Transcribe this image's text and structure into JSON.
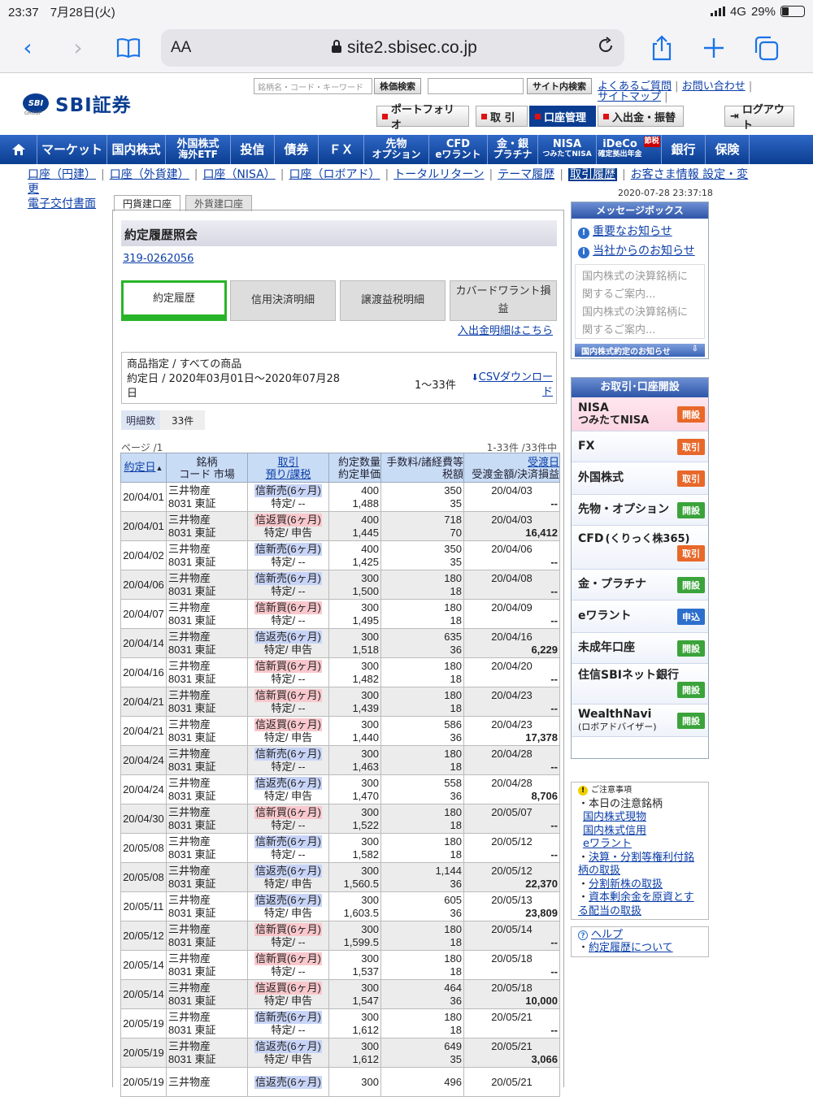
{
  "status": {
    "time": "23:37",
    "date": "7月28日(火)",
    "network": "4G",
    "battery": "29%",
    "battery_level": 0.29
  },
  "browser": {
    "text_size": "AA",
    "url": "site2.sbisec.co.jp",
    "icons": [
      "back-icon",
      "forward-icon",
      "bookmarks-icon",
      "lock-icon",
      "reload-icon",
      "share-icon",
      "add-icon",
      "tabs-icon"
    ]
  },
  "header": {
    "logo_mark": "SBI",
    "logo_sub": "GROUP",
    "logo_text": "SBI証券",
    "search_placeholder": "銘柄名・コード・キーワード",
    "stock_search": "株価検索",
    "site_search": "サイト内検索",
    "faq": "よくあるご質問",
    "contact": "お問い合わせ",
    "sitemap": "サイトマップ",
    "portfolio": "ポートフォリオ",
    "trade": "取 引",
    "account": "口座管理",
    "deposit": "入出金・振替",
    "logout": "ログアウト"
  },
  "mainnav": [
    {
      "label": "",
      "icon": "home-icon"
    },
    {
      "label": "マーケット"
    },
    {
      "label": "国内株式"
    },
    {
      "label": "外国株式",
      "sub": "海外ETF"
    },
    {
      "label": "投信"
    },
    {
      "label": "債券"
    },
    {
      "label": "ＦＸ"
    },
    {
      "label": "先物",
      "sub": "オプション"
    },
    {
      "label": "CFD",
      "sub": "eワラント"
    },
    {
      "label": "金・銀",
      "sub": "プラチナ"
    },
    {
      "label": "NISA",
      "sub": "つみたてNISA"
    },
    {
      "label": "iDeCo",
      "sub": "確定拠出年金",
      "badge": "節税"
    },
    {
      "label": "銀行"
    },
    {
      "label": "保険"
    }
  ],
  "subnav": [
    "口座（円建）",
    "口座（外貨建）",
    "口座（NISA）",
    "口座（ロボアド）",
    "トータルリターン",
    "テーマ履歴",
    "取引履歴",
    "お客さま情報 設定・変更",
    "電子交付書面"
  ],
  "timestamp": "2020-07-28 23:37:18",
  "account_tabs": [
    "円貨建口座",
    "外貨建口座"
  ],
  "page_title": "約定履歴照会",
  "account_no": "319-0262056",
  "content_tabs": [
    "約定履歴",
    "信用決済明細",
    "譲渡益税明細",
    "カバードワラント損益"
  ],
  "deposit_link": "入出金明細はこちら",
  "filter": {
    "product": "商品指定 / すべての商品",
    "period": "約定日 / 2020年03月01日〜2020年07月28日",
    "range": "1〜33件",
    "csv": "CSVダウンロード"
  },
  "count": {
    "label": "明細数",
    "value": "33件"
  },
  "page": {
    "label": "ページ /1",
    "summary": "1-33件 /33件中"
  },
  "table": {
    "headers": {
      "date": "約定日",
      "sort_mark": "▲",
      "name1": "銘柄",
      "name2": "コード 市場",
      "kind1": "取引",
      "kind2": "預り/課税",
      "qty1": "約定数量",
      "qty2": "約定単価",
      "fee1": "手数料/諸経費等",
      "fee2": "税額",
      "settle1": "受渡日",
      "settle2": "受渡金額/決済損益"
    },
    "rows": [
      {
        "date": "20/04/01",
        "name": "三井物産",
        "code": "8031",
        "market": "東証",
        "kind": "信新売(6ヶ月)",
        "side": "sell",
        "tax": "特定/ --",
        "qty": "400",
        "price": "1,488",
        "fee": "350",
        "taxamt": "35",
        "settle": "20/04/03",
        "amount": "--"
      },
      {
        "date": "20/04/01",
        "name": "三井物産",
        "code": "8031",
        "market": "東証",
        "kind": "信返買(6ヶ月)",
        "side": "buy",
        "tax": "特定/ 申告",
        "qty": "400",
        "price": "1,445",
        "fee": "718",
        "taxamt": "70",
        "settle": "20/04/03",
        "amount": "16,412"
      },
      {
        "date": "20/04/02",
        "name": "三井物産",
        "code": "8031",
        "market": "東証",
        "kind": "信新売(6ヶ月)",
        "side": "sell",
        "tax": "特定/ --",
        "qty": "400",
        "price": "1,425",
        "fee": "350",
        "taxamt": "35",
        "settle": "20/04/06",
        "amount": "--"
      },
      {
        "date": "20/04/06",
        "name": "三井物産",
        "code": "8031",
        "market": "東証",
        "kind": "信新売(6ヶ月)",
        "side": "sell",
        "tax": "特定/ --",
        "qty": "300",
        "price": "1,500",
        "fee": "180",
        "taxamt": "18",
        "settle": "20/04/08",
        "amount": "--"
      },
      {
        "date": "20/04/07",
        "name": "三井物産",
        "code": "8031",
        "market": "東証",
        "kind": "信新買(6ヶ月)",
        "side": "buy",
        "tax": "特定/ --",
        "qty": "300",
        "price": "1,495",
        "fee": "180",
        "taxamt": "18",
        "settle": "20/04/09",
        "amount": "--"
      },
      {
        "date": "20/04/14",
        "name": "三井物産",
        "code": "8031",
        "market": "東証",
        "kind": "信返売(6ヶ月)",
        "side": "sell",
        "tax": "特定/ 申告",
        "qty": "300",
        "price": "1,518",
        "fee": "635",
        "taxamt": "36",
        "settle": "20/04/16",
        "amount": "6,229"
      },
      {
        "date": "20/04/16",
        "name": "三井物産",
        "code": "8031",
        "market": "東証",
        "kind": "信新買(6ヶ月)",
        "side": "buy",
        "tax": "特定/ --",
        "qty": "300",
        "price": "1,482",
        "fee": "180",
        "taxamt": "18",
        "settle": "20/04/20",
        "amount": "--"
      },
      {
        "date": "20/04/21",
        "name": "三井物産",
        "code": "8031",
        "market": "東証",
        "kind": "信新買(6ヶ月)",
        "side": "buy",
        "tax": "特定/ --",
        "qty": "300",
        "price": "1,439",
        "fee": "180",
        "taxamt": "18",
        "settle": "20/04/23",
        "amount": "--"
      },
      {
        "date": "20/04/21",
        "name": "三井物産",
        "code": "8031",
        "market": "東証",
        "kind": "信返買(6ヶ月)",
        "side": "buy",
        "tax": "特定/ 申告",
        "qty": "300",
        "price": "1,440",
        "fee": "586",
        "taxamt": "36",
        "settle": "20/04/23",
        "amount": "17,378"
      },
      {
        "date": "20/04/24",
        "name": "三井物産",
        "code": "8031",
        "market": "東証",
        "kind": "信新売(6ヶ月)",
        "side": "sell",
        "tax": "特定/ --",
        "qty": "300",
        "price": "1,463",
        "fee": "180",
        "taxamt": "18",
        "settle": "20/04/28",
        "amount": "--"
      },
      {
        "date": "20/04/24",
        "name": "三井物産",
        "code": "8031",
        "market": "東証",
        "kind": "信返売(6ヶ月)",
        "side": "sell",
        "tax": "特定/ 申告",
        "qty": "300",
        "price": "1,470",
        "fee": "558",
        "taxamt": "36",
        "settle": "20/04/28",
        "amount": "8,706"
      },
      {
        "date": "20/04/30",
        "name": "三井物産",
        "code": "8031",
        "market": "東証",
        "kind": "信新買(6ヶ月)",
        "side": "buy",
        "tax": "特定/ --",
        "qty": "300",
        "price": "1,522",
        "fee": "180",
        "taxamt": "18",
        "settle": "20/05/07",
        "amount": "--"
      },
      {
        "date": "20/05/08",
        "name": "三井物産",
        "code": "8031",
        "market": "東証",
        "kind": "信新売(6ヶ月)",
        "side": "sell",
        "tax": "特定/ --",
        "qty": "300",
        "price": "1,582",
        "fee": "180",
        "taxamt": "18",
        "settle": "20/05/12",
        "amount": "--"
      },
      {
        "date": "20/05/08",
        "name": "三井物産",
        "code": "8031",
        "market": "東証",
        "kind": "信返売(6ヶ月)",
        "side": "sell",
        "tax": "特定/ 申告",
        "qty": "300",
        "price": "1,560.5",
        "fee": "1,144",
        "taxamt": "36",
        "settle": "20/05/12",
        "amount": "22,370"
      },
      {
        "date": "20/05/11",
        "name": "三井物産",
        "code": "8031",
        "market": "東証",
        "kind": "信返売(6ヶ月)",
        "side": "sell",
        "tax": "特定/ 申告",
        "qty": "300",
        "price": "1,603.5",
        "fee": "605",
        "taxamt": "36",
        "settle": "20/05/13",
        "amount": "23,809"
      },
      {
        "date": "20/05/12",
        "name": "三井物産",
        "code": "8031",
        "market": "東証",
        "kind": "信新買(6ヶ月)",
        "side": "buy",
        "tax": "特定/ --",
        "qty": "300",
        "price": "1,599.5",
        "fee": "180",
        "taxamt": "18",
        "settle": "20/05/14",
        "amount": "--"
      },
      {
        "date": "20/05/14",
        "name": "三井物産",
        "code": "8031",
        "market": "東証",
        "kind": "信新買(6ヶ月)",
        "side": "buy",
        "tax": "特定/ --",
        "qty": "300",
        "price": "1,537",
        "fee": "180",
        "taxamt": "18",
        "settle": "20/05/18",
        "amount": "--"
      },
      {
        "date": "20/05/14",
        "name": "三井物産",
        "code": "8031",
        "market": "東証",
        "kind": "信返買(6ヶ月)",
        "side": "buy",
        "tax": "特定/ 申告",
        "qty": "300",
        "price": "1,547",
        "fee": "464",
        "taxamt": "36",
        "settle": "20/05/18",
        "amount": "10,000"
      },
      {
        "date": "20/05/19",
        "name": "三井物産",
        "code": "8031",
        "market": "東証",
        "kind": "信新売(6ヶ月)",
        "side": "sell",
        "tax": "特定/ --",
        "qty": "300",
        "price": "1,612",
        "fee": "180",
        "taxamt": "18",
        "settle": "20/05/21",
        "amount": "--"
      },
      {
        "date": "20/05/19",
        "name": "三井物産",
        "code": "8031",
        "market": "東証",
        "kind": "信返売(6ヶ月)",
        "side": "sell",
        "tax": "特定/ 申告",
        "qty": "300",
        "price": "1,612",
        "fee": "649",
        "taxamt": "35",
        "settle": "20/05/21",
        "amount": "3,066"
      },
      {
        "date": "20/05/19",
        "name": "三井物産",
        "code": "",
        "market": "",
        "kind": "信返売(6ヶ月)",
        "side": "sell",
        "tax": "",
        "qty": "300",
        "price": "",
        "fee": "496",
        "taxamt": "",
        "settle": "20/05/21",
        "amount": ""
      }
    ]
  },
  "messagebox": {
    "title": "メッセージボックス",
    "important": "重要なお知らせ",
    "notice": "当社からのお知らせ",
    "items": [
      "国内株式の決算銘柄に関するご案内...",
      "国内株式の決算銘柄に関するご案内..."
    ],
    "footer": "国内株式約定のお知らせ"
  },
  "trading": {
    "title": "お取引･口座開設",
    "items": [
      {
        "label": "NISA",
        "sub": "つみたてNISA",
        "btn": "開設",
        "type": "trade"
      },
      {
        "label": "FX",
        "btn": "取引",
        "type": "trade"
      },
      {
        "label": "外国株式",
        "btn": "取引",
        "type": "trade"
      },
      {
        "label": "先物・オプション",
        "btn": "開設",
        "type": "open"
      },
      {
        "label": "CFD",
        "sub": "(くりっく株365)",
        "btn": "取引",
        "type": "trade"
      },
      {
        "label": "金・プラチナ",
        "btn": "開設",
        "type": "open"
      },
      {
        "label": "eワラント",
        "btn": "申込",
        "type": "apply"
      },
      {
        "label": "未成年口座",
        "btn": "開設",
        "type": "open"
      },
      {
        "label": "住信SBIネット銀行",
        "btn": "開設",
        "type": "open"
      },
      {
        "label": "WealthNavi",
        "sub": "(ロボアドバイザー)",
        "btn": "開設",
        "type": "open"
      }
    ]
  },
  "caution": {
    "title": "ご注意事項",
    "lead": "・本日の注意銘柄",
    "links": [
      "国内株式現物",
      "国内株式信用",
      "eワラント"
    ],
    "links2": [
      "決算・分割等権利付銘柄の取扱",
      "分割新株の取扱",
      "資本剰余金を原資とする配当の取扱"
    ]
  },
  "help": {
    "title": "ヘルプ",
    "link": "約定履歴について"
  }
}
